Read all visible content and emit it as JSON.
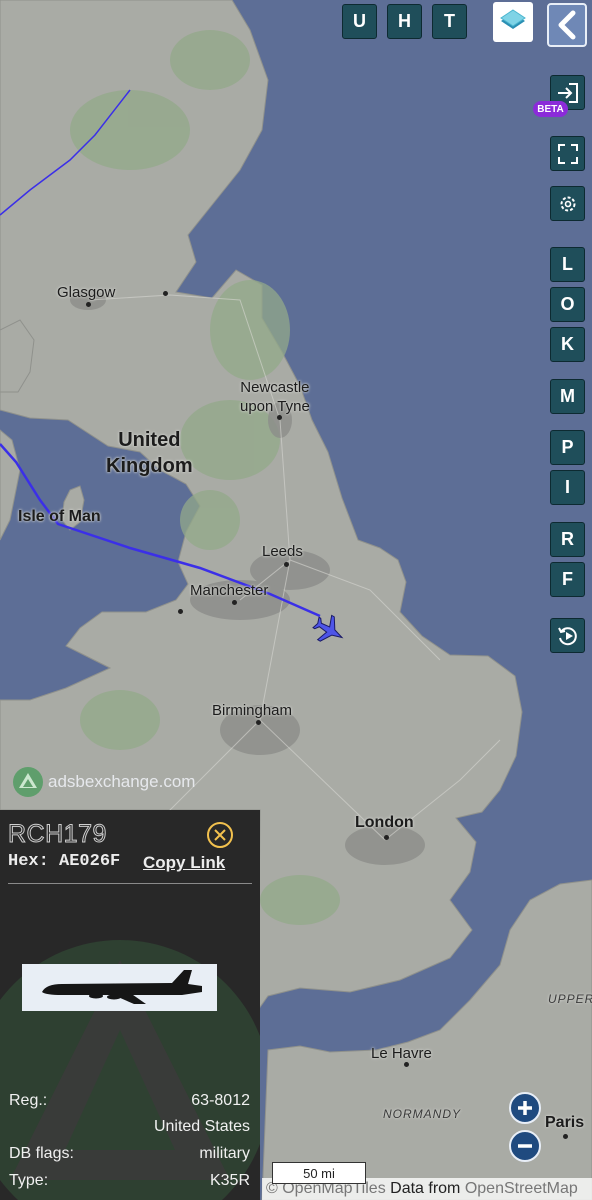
{
  "top_buttons": [
    "U",
    "H",
    "T"
  ],
  "beta_label": "BETA",
  "side_buttons": [
    "L",
    "O",
    "K",
    "M",
    "P",
    "I",
    "R",
    "F"
  ],
  "map_labels": {
    "glasgow": "Glasgow",
    "newcastle": "Newcastle\nupon Tyne",
    "united_kingdom": "United\nKingdom",
    "isle_of_man": "Isle of Man",
    "leeds": "Leeds",
    "manchester": "Manchester",
    "birmingham": "Birmingham",
    "london": "London",
    "le_havre": "Le Havre",
    "normandy": "NORMANDY",
    "upper": "UPPER",
    "paris": "Paris"
  },
  "watermark": "adsbexchange.com",
  "panel": {
    "callsign": "RCH179",
    "hex_label": "Hex:",
    "hex_value": "AE026F",
    "copy_link": "Copy Link",
    "rows": [
      {
        "label": "Reg.:",
        "value": "63-8012"
      },
      {
        "label": "",
        "value": "United States"
      },
      {
        "label": "DB flags:",
        "value": "military"
      },
      {
        "label": "Type:",
        "value": "K35R"
      }
    ]
  },
  "scale": "50 mi",
  "attribution": {
    "prefix": "© OpenMapTiles",
    "middle": " Data from ",
    "suffix": "OpenStreetMap"
  },
  "colors": {
    "sea": "#5d6e96",
    "land": "#a9aba5",
    "track": "#3b2fe8",
    "button": "#1f4e5a",
    "beta": "#8b2bd9"
  }
}
